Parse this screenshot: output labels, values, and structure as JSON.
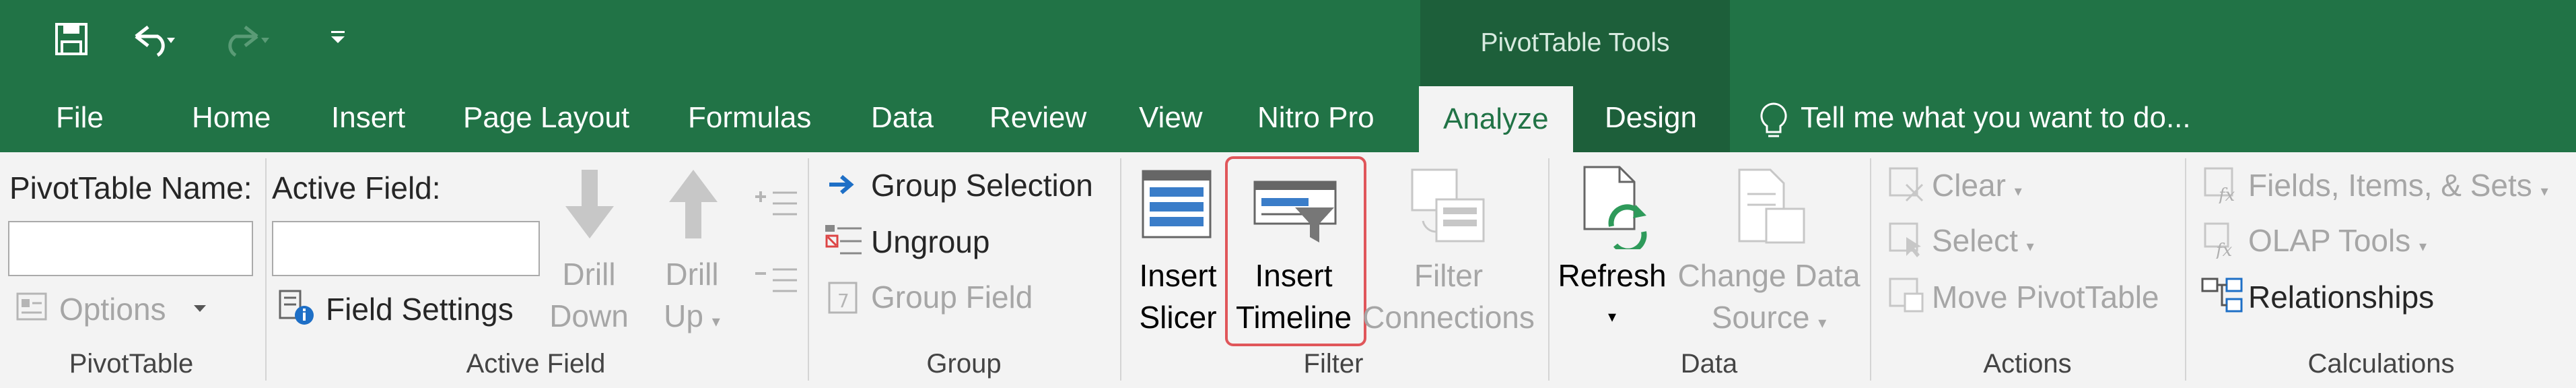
{
  "context_label": "PivotTable Tools",
  "tabs": [
    "File",
    "Home",
    "Insert",
    "Page Layout",
    "Formulas",
    "Data",
    "Review",
    "View",
    "Nitro Pro"
  ],
  "active_tab": "Analyze",
  "design_tab": "Design",
  "tellme": "Tell me what you want to do...",
  "pivottable": {
    "name_label": "PivotTable Name:",
    "options": "Options",
    "group": "PivotTable"
  },
  "active_field": {
    "label": "Active Field:",
    "field_settings": "Field Settings",
    "drill_down_1": "Drill",
    "drill_down_2": "Down",
    "drill_up_1": "Drill",
    "drill_up_2": "Up",
    "group": "Active Field"
  },
  "group": {
    "group_selection": "Group Selection",
    "ungroup": "Ungroup",
    "group_field": "Group Field",
    "group": "Group"
  },
  "filter": {
    "insert_slicer_1": "Insert",
    "insert_slicer_2": "Slicer",
    "insert_timeline_1": "Insert",
    "insert_timeline_2": "Timeline",
    "filter_conn_1": "Filter",
    "filter_conn_2": "Connections",
    "group": "Filter"
  },
  "data": {
    "refresh": "Refresh",
    "change_source_1": "Change Data",
    "change_source_2": "Source",
    "group": "Data"
  },
  "actions": {
    "clear": "Clear",
    "select": "Select",
    "move": "Move PivotTable",
    "group": "Actions"
  },
  "calculations": {
    "fields": "Fields, Items, & Sets",
    "olap": "OLAP Tools",
    "relationships": "Relationships",
    "group": "Calculations"
  }
}
